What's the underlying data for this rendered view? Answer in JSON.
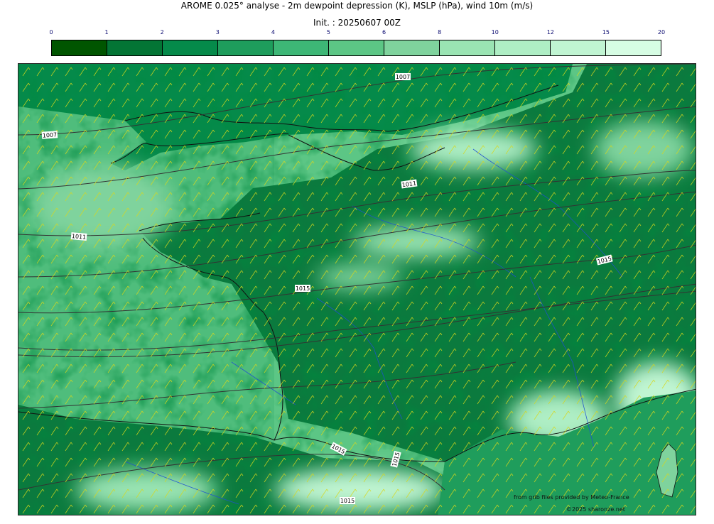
{
  "header": {
    "title": "AROME 0.025° analyse - 2m dewpoint depression (K), MSLP (hPa), wind 10m (m/s)",
    "init": "Init. : 20250607 00Z"
  },
  "colorbar": {
    "ticks": [
      "0",
      "1",
      "2",
      "3",
      "4",
      "5",
      "6",
      "8",
      "10",
      "12",
      "15",
      "20"
    ],
    "colors": [
      "#005500",
      "#037535",
      "#058a4a",
      "#1e9d5c",
      "#3db776",
      "#5cc685",
      "#7fd39d",
      "#9ae4b3",
      "#aeeec4",
      "#c0f5d2",
      "#d6fde3"
    ]
  },
  "map": {
    "isobar_labels": [
      {
        "text": "1007"
      },
      {
        "text": "1007"
      },
      {
        "text": "1011"
      },
      {
        "text": "1011"
      },
      {
        "text": "1015"
      },
      {
        "text": "1015"
      },
      {
        "text": "1015"
      },
      {
        "text": "1015"
      },
      {
        "text": "1015"
      }
    ],
    "colors": {
      "sea": "#5cc685",
      "land_dark": "#005500",
      "land_mid": "#058a4a",
      "light": "#aeeec4",
      "coast": "#111111",
      "rivers": "#1f4fd1",
      "wind_barbs": "#d8d81a",
      "isobars": "#333333"
    }
  },
  "credits": {
    "line1": "from grib files provided by Meteo-France",
    "line2": "©2025 sharonze.net"
  }
}
